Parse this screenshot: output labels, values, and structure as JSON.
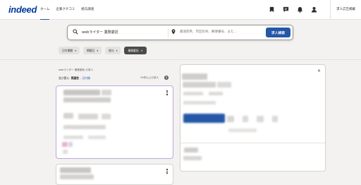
{
  "brand": {
    "logo": "indeed"
  },
  "nav": {
    "items": [
      {
        "label": "ホーム"
      },
      {
        "label": "企業クチコミ"
      },
      {
        "label": "給与調査"
      }
    ]
  },
  "header": {
    "employer_link": "求人広告掲載"
  },
  "search": {
    "what_value": "webライター 業務委託",
    "where_placeholder": "都道府県、市区町村、郵便番号、また…",
    "button_label": "求人検索"
  },
  "filters": [
    {
      "label": "日付期間"
    },
    {
      "label": "掲載日"
    },
    {
      "label": "給与"
    },
    {
      "label": "業務委託",
      "selected": true
    }
  ],
  "results": {
    "query_summary": "webライター 業務委託 の求人",
    "sort_prefix": "並び替え: ",
    "sort_current": "関連性",
    "sort_sep": " – ",
    "sort_alt": "日付順",
    "count": "29件以上の求人",
    "help": "?"
  },
  "detail": {
    "close": "×"
  },
  "colors": {
    "brand_blue": "#2557a7",
    "logo_blue": "#003a9b",
    "selected_chip": "#4b4b4b"
  }
}
